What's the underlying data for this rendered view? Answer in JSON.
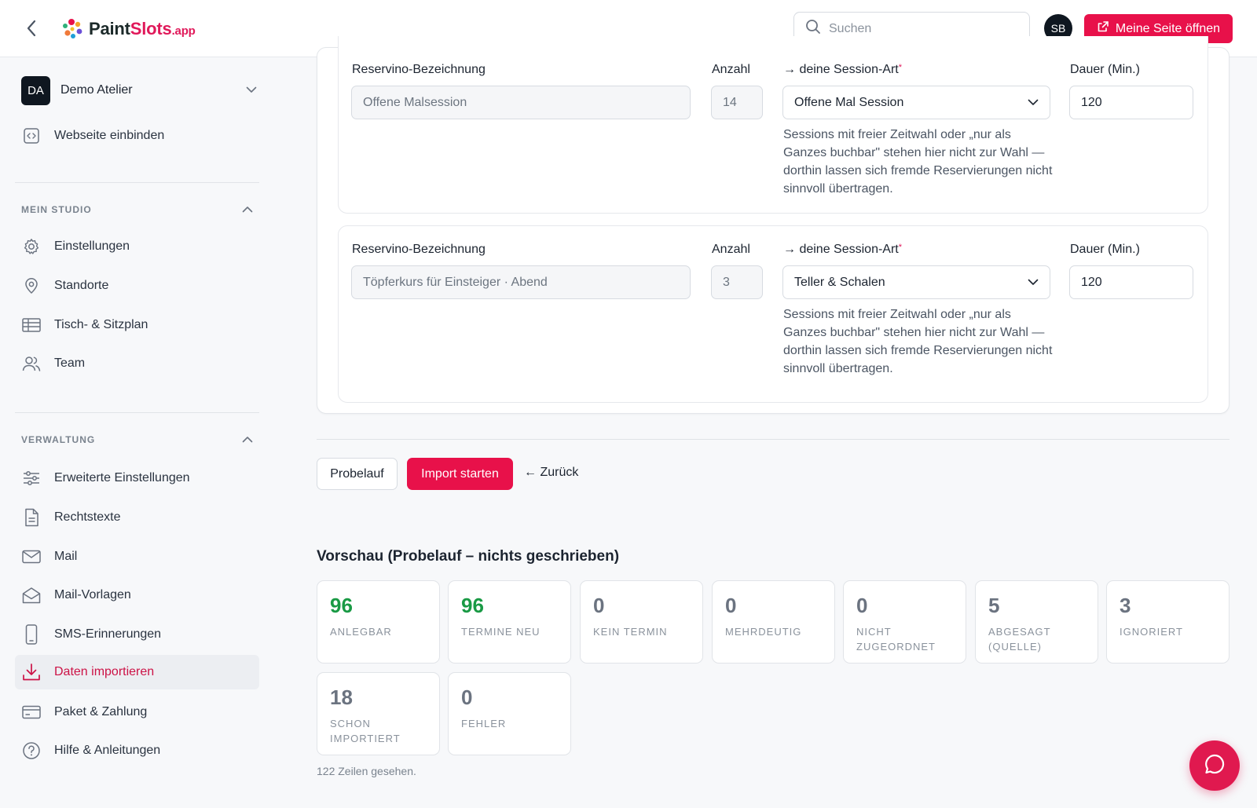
{
  "header": {
    "logo_text_main": "Paint",
    "logo_text_accent": "Slots",
    "logo_text_suffix": ".app",
    "search_placeholder": "Suchen",
    "user_initials": "SB",
    "open_page_label": "Meine Seite öffnen"
  },
  "sidebar": {
    "studio_initials": "DA",
    "studio_name": "Demo Atelier",
    "embed_label": "Webseite einbinden",
    "section_studio": "MEIN STUDIO",
    "studio_items": [
      "Einstellungen",
      "Standorte",
      "Tisch- & Sitzplan",
      "Team"
    ],
    "section_admin": "VERWALTUNG",
    "admin_items": [
      "Erweiterte Einstellungen",
      "Rechtstexte",
      "Mail",
      "Mail-Vorlagen",
      "SMS-Erinnerungen",
      "Daten importieren",
      "Paket & Zahlung",
      "Hilfe & Anleitungen"
    ],
    "active_item": "Daten importieren"
  },
  "mapping": {
    "label_name": "Reservino-Bezeichnung",
    "label_count": "Anzahl",
    "label_type": "→ deine Session-Art",
    "label_duration": "Dauer (Min.)",
    "hint": "Sessions mit freier Zeitwahl oder „nur als Ganzes buchbar\" stehen hier nicht zur Wahl — dorthin lassen sich fremde Reservierungen nicht sinnvoll übertragen.",
    "rows": [
      {
        "name": "Offene Malsession",
        "count": "14",
        "type": "Offene Mal Session",
        "duration": "120"
      },
      {
        "name": "Töpferkurs für Einsteiger · Abend",
        "count": "3",
        "type": "Teller & Schalen",
        "duration": "120"
      }
    ]
  },
  "actions": {
    "dry_run": "Probelauf",
    "start_import": "Import starten",
    "back": "← Zurück"
  },
  "preview": {
    "title": "Vorschau (Probelauf – nichts geschrieben)",
    "stats": [
      {
        "value": "96",
        "label": "ANLEGBAR",
        "highlight": true
      },
      {
        "value": "96",
        "label": "TERMINE NEU",
        "highlight": true
      },
      {
        "value": "0",
        "label": "KEIN TERMIN",
        "highlight": false
      },
      {
        "value": "0",
        "label": "MEHRDEUTIG",
        "highlight": false
      },
      {
        "value": "0",
        "label": "NICHT ZUGEORDNET",
        "highlight": false
      },
      {
        "value": "5",
        "label": "ABGESAGT (QUELLE)",
        "highlight": false
      },
      {
        "value": "3",
        "label": "IGNORIERT",
        "highlight": false
      },
      {
        "value": "18",
        "label": "SCHON IMPORTIERT",
        "highlight": false
      },
      {
        "value": "0",
        "label": "FEHLER",
        "highlight": false
      }
    ],
    "rows_seen": "122 Zeilen gesehen."
  },
  "colors": {
    "brand": "#e8114a",
    "success": "#1a9a45",
    "sidebar_active_text": "#cc1246"
  },
  "icons": {
    "back": "chevron-left-icon",
    "search": "search-icon",
    "external": "external-link-icon",
    "chat": "chat-bubble-icon"
  }
}
